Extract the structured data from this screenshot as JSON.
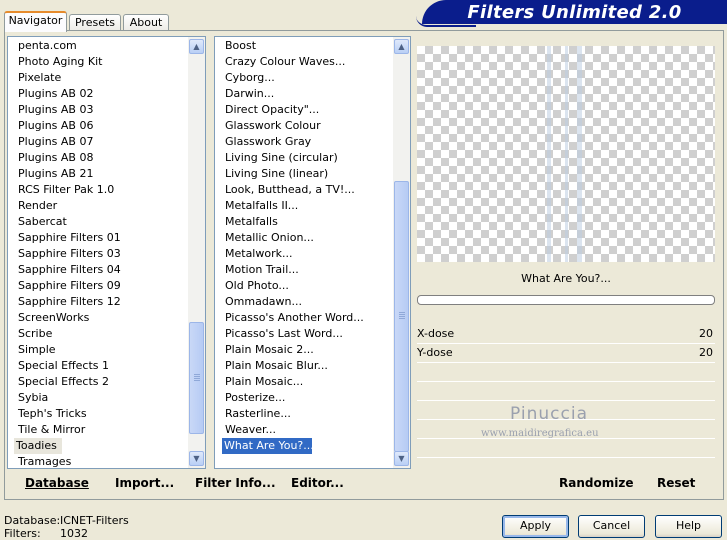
{
  "tabs": [
    "Navigator",
    "Presets",
    "About"
  ],
  "window_title": "Filters Unlimited 2.0",
  "categories": [
    "penta.com",
    "Photo Aging Kit",
    "Pixelate",
    "Plugins AB 02",
    "Plugins AB 03",
    "Plugins AB 06",
    "Plugins AB 07",
    "Plugins AB 08",
    "Plugins AB 21",
    "RCS Filter Pak 1.0",
    "Render",
    "Sabercat",
    "Sapphire Filters 01",
    "Sapphire Filters 03",
    "Sapphire Filters 04",
    "Sapphire Filters 09",
    "Sapphire Filters 12",
    "ScreenWorks",
    "Scribe",
    "Simple",
    "Special Effects 1",
    "Special Effects 2",
    "Sybia",
    "Teph's Tricks",
    "Tile & Mirror",
    "Toadies",
    "Tramages"
  ],
  "categories_selected": "Toadies",
  "filters": [
    "Boost",
    "Crazy Colour Waves...",
    "Cyborg...",
    "Darwin...",
    "Direct Opacity\"...",
    "Glasswork Colour",
    "Glasswork Gray",
    "Living Sine (circular)",
    "Living Sine (linear)",
    "Look, Butthead, a TV!...",
    "Metalfalls II...",
    "Metalfalls",
    "Metallic Onion...",
    "Metalwork...",
    "Motion Trail...",
    "Old Photo...",
    "Ommadawn...",
    "Picasso's Another Word...",
    "Picasso's Last Word...",
    "Plain Mosaic 2...",
    "Plain Mosaic Blur...",
    "Plain Mosaic...",
    "Posterize...",
    "Rasterline...",
    "Weaver...",
    "What Are You?..."
  ],
  "filters_selected": "What Are You?...",
  "selected_filter_name": "What Are You?...",
  "params": [
    {
      "label": "X-dose",
      "value": "20"
    },
    {
      "label": "Y-dose",
      "value": "20"
    }
  ],
  "watermark": {
    "name": "Pinuccia",
    "url": "www.maidiregrafica.eu"
  },
  "toolbar": {
    "database": "Database",
    "import": "Import...",
    "filter_info": "Filter Info...",
    "editor": "Editor...",
    "randomize": "Randomize",
    "reset": "Reset"
  },
  "status": {
    "database_label": "Database:",
    "database_value": "ICNET-Filters",
    "filters_label": "Filters:",
    "filters_value": "1032"
  },
  "buttons": {
    "apply": "Apply",
    "cancel": "Cancel",
    "help": "Help"
  }
}
